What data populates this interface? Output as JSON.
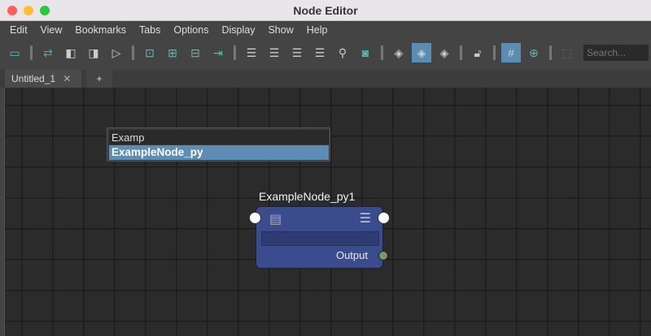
{
  "window": {
    "title": "Node Editor"
  },
  "menu": [
    "Edit",
    "View",
    "Bookmarks",
    "Tabs",
    "Options",
    "Display",
    "Show",
    "Help"
  ],
  "toolbar": {
    "search_placeholder": "Search..."
  },
  "tabs": [
    {
      "label": "Untitled_1",
      "close": "✕"
    },
    {
      "label": "+"
    }
  ],
  "node_search": {
    "value": "Examp",
    "suggestion": "ExampleNode_py"
  },
  "node": {
    "title": "ExampleNode_py1",
    "output_label": "Output"
  }
}
